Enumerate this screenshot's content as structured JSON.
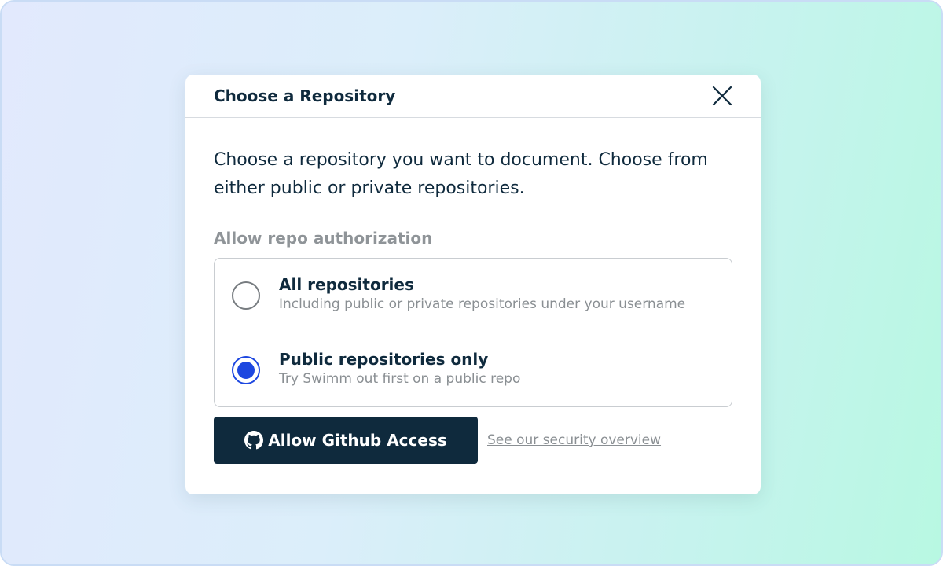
{
  "modal": {
    "title": "Choose a Repository",
    "close_icon": "close-icon",
    "description": "Choose a repository you want to document. Choose from either public or private repositories.",
    "section_label": "Allow repo authorization",
    "options": [
      {
        "title": "All repositories",
        "subtitle": "Including public or private repositories under your username",
        "selected": false
      },
      {
        "title": "Public repositories only",
        "subtitle": "Try Swimm out first on a public repo",
        "selected": true
      }
    ],
    "primary_button": {
      "label": "Allow Github Access",
      "icon": "github-icon"
    },
    "security_link": "See our security overview"
  },
  "colors": {
    "primary": "#0f2a3d",
    "radio_selected": "#1d47e0",
    "muted_text": "#8a8f93"
  }
}
